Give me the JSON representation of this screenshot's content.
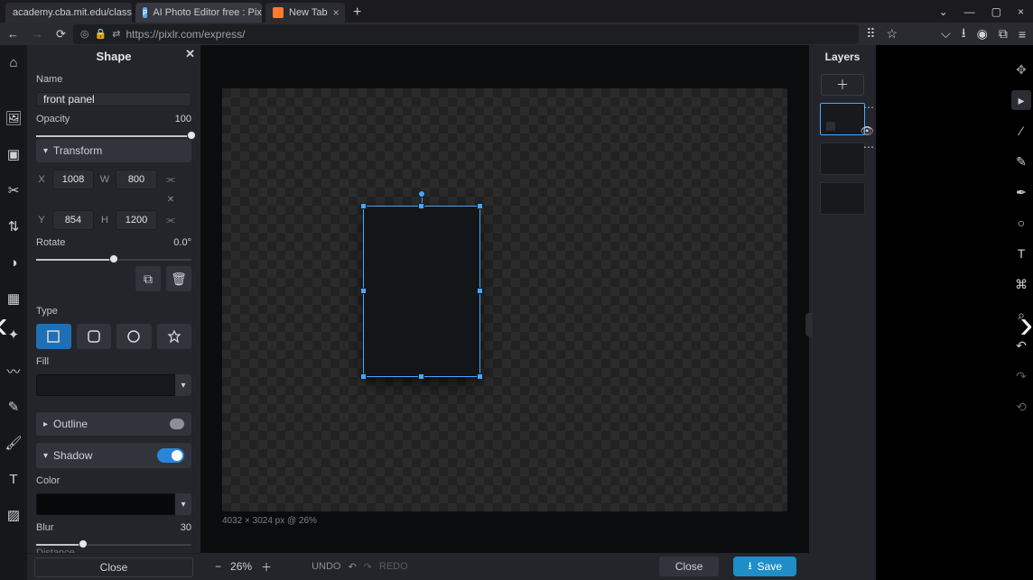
{
  "browser": {
    "tabs": [
      {
        "label": "academy.cba.mit.edu/classes/comp"
      },
      {
        "label": "AI Photo Editor free : Pixlr Expre"
      },
      {
        "label": "New Tab"
      }
    ],
    "url": "https://pixlr.com/express/"
  },
  "panel": {
    "title": "Shape",
    "name_label": "Name",
    "name_value": "front panel",
    "opacity_label": "Opacity",
    "opacity_value": "100",
    "transform_label": "Transform",
    "x_label": "X",
    "x_value": "1008",
    "y_label": "Y",
    "y_value": "854",
    "w_label": "W",
    "w_value": "800",
    "h_label": "H",
    "h_value": "1200",
    "rotate_label": "Rotate",
    "rotate_value": "0.0°",
    "type_label": "Type",
    "fill_label": "Fill",
    "outline_label": "Outline",
    "shadow_label": "Shadow",
    "color_label": "Color",
    "blur_label": "Blur",
    "blur_value": "30",
    "distance_label": "Distance",
    "close_button": "Close"
  },
  "canvas": {
    "info": "4032 × 3024 px @ 26%"
  },
  "bottom": {
    "zoom": "26%",
    "undo": "UNDO",
    "redo": "REDO",
    "close": "Close",
    "save": "Save"
  },
  "layers": {
    "title": "Layers"
  },
  "icons": {
    "rect": "rect",
    "rrect": "rrect",
    "ellipse": "ellipse",
    "star": "star"
  }
}
